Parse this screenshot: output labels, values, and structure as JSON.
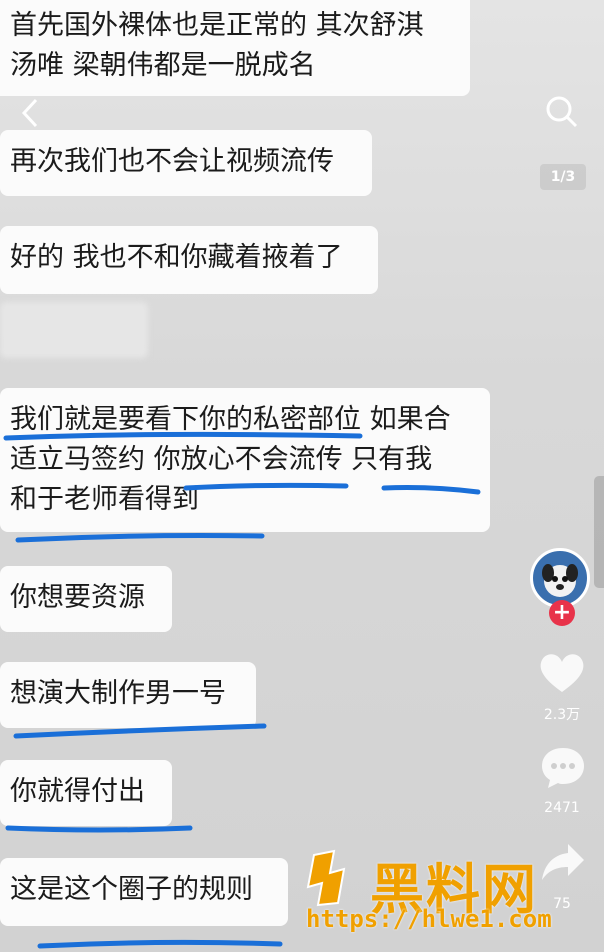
{
  "messages": [
    {
      "text": [
        "首先国外裸体也是正常的 其次舒淇",
        "汤唯 梁朝伟都是一脱成名"
      ]
    },
    {
      "text": [
        "再次我们也不会让视频流传"
      ]
    },
    {
      "text": [
        "好的 我也不和你藏着掖着了"
      ]
    },
    {
      "text": [
        "我们就是要看下你的私密部位 如果合",
        "适立马签约 你放心不会流传 只有我",
        "和于老师看得到"
      ]
    },
    {
      "text": [
        "你想要资源"
      ]
    },
    {
      "text": [
        "想演大制作男一号"
      ]
    },
    {
      "text": [
        "你就得付出"
      ]
    },
    {
      "text": [
        "这是这个圈子的规则"
      ]
    }
  ],
  "overlay": {
    "page_indicator": "1/3",
    "like_count": "2.3万",
    "comment_count": "2471",
    "share_count": "75"
  },
  "watermark": {
    "title": "黑料网",
    "url": "https://hlwe1.com"
  },
  "colors": {
    "underline": "#1a6fd8",
    "watermark": "#f0a000",
    "follow": "#e8334a"
  },
  "icons": [
    "back-icon",
    "search-icon",
    "heart-icon",
    "comment-icon",
    "share-icon",
    "plus-icon"
  ]
}
